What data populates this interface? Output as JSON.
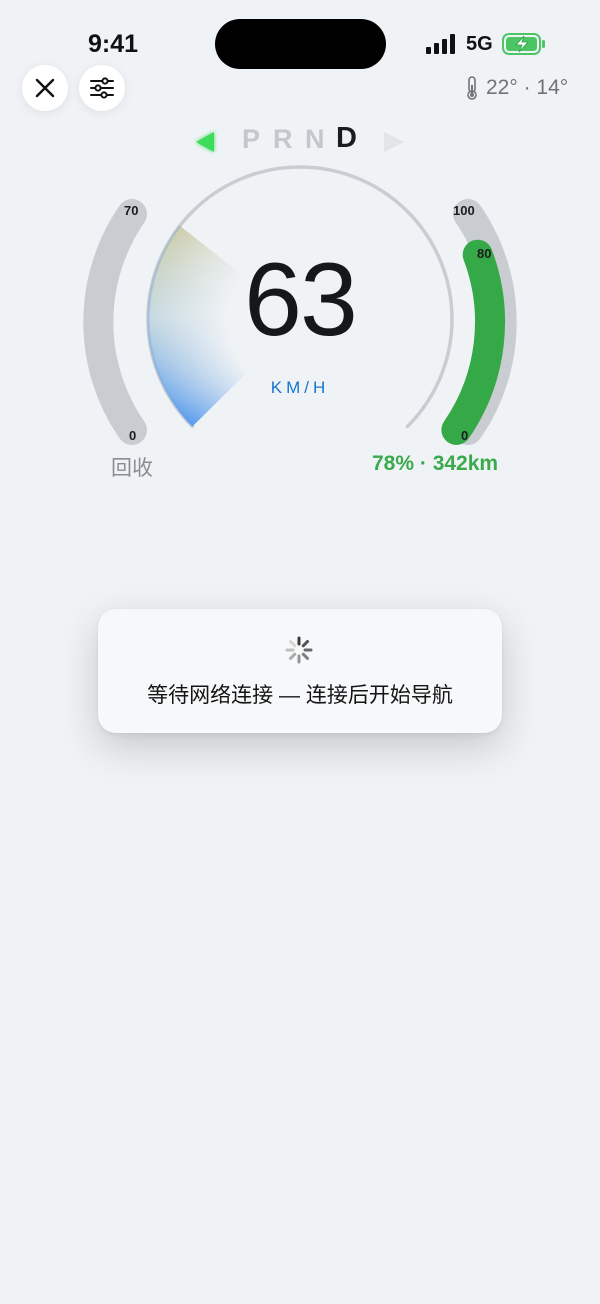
{
  "status_bar": {
    "time": "9:41",
    "network": "5G",
    "signal_bars": 4,
    "battery_state": "charging",
    "icons": [
      "signal-icon",
      "battery-charging-icon"
    ]
  },
  "toolbar": {
    "close_icon": "close-icon",
    "settings_icon": "sliders-icon"
  },
  "weather": {
    "icon": "thermometer-icon",
    "text": "22° · 14°"
  },
  "gear_selector": {
    "left_arrow_icon": "arrow-left-icon",
    "right_arrow_icon": "arrow-right-icon",
    "gears": [
      "P",
      "R",
      "N",
      "D"
    ],
    "active": "D"
  },
  "speedometer": {
    "speed": "63",
    "unit": "KM/H"
  },
  "regen_gauge": {
    "max_label": "70",
    "min_label": "0",
    "label": "回收"
  },
  "battery_gauge": {
    "max_label": "100",
    "level_label": "80",
    "min_label": "0",
    "level_fraction": 0.8,
    "summary": "78% · 342km"
  },
  "toast": {
    "spinner_icon": "spinner-icon",
    "message": "等待网络连接 — 连接后开始导航"
  },
  "colors": {
    "accent_blue": "#1576d1",
    "battery_green": "#35a847",
    "gear_green": "#3ddc5a",
    "track_gray": "#c9ccd0"
  }
}
